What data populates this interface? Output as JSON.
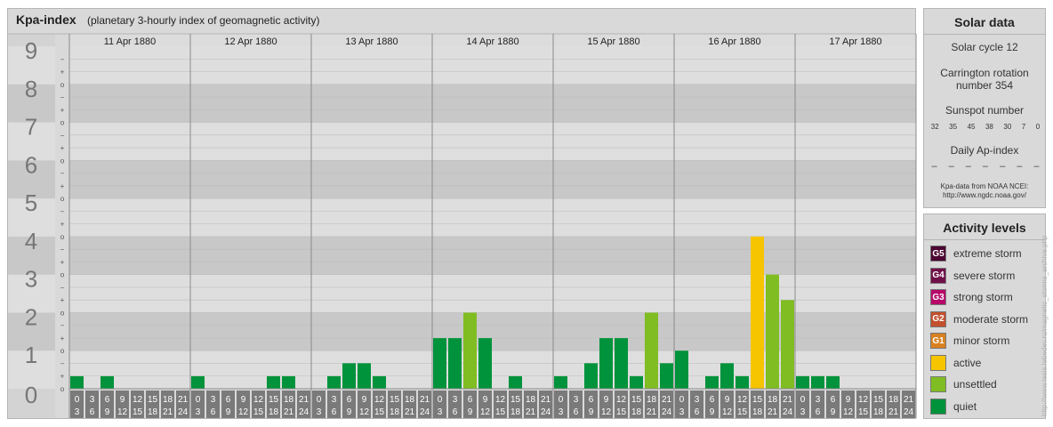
{
  "header": {
    "title": "Kpa-index",
    "subtitle": "(planetary 3-hourly index of geomagnetic activity)"
  },
  "chart_data": {
    "type": "bar",
    "ylim": [
      0,
      9
    ],
    "y_ticks": [
      "0",
      "1",
      "2",
      "3",
      "4",
      "5",
      "6",
      "7",
      "8",
      "9"
    ],
    "y_minor_marks": [
      "+",
      "o",
      "−"
    ],
    "days": [
      "11 Apr 1880",
      "12 Apr 1880",
      "13 Apr 1880",
      "14 Apr 1880",
      "15 Apr 1880",
      "16 Apr 1880",
      "17 Apr 1880"
    ],
    "interval_start_labels": [
      "0",
      "3",
      "6",
      "9",
      "12",
      "15",
      "18",
      "21"
    ],
    "interval_end_labels": [
      "3",
      "6",
      "9",
      "12",
      "15",
      "18",
      "21",
      "24"
    ],
    "values": [
      [
        0.33,
        0,
        0.33,
        0,
        0,
        0,
        0,
        0
      ],
      [
        0.33,
        0,
        0,
        0,
        0,
        0.33,
        0.33,
        0
      ],
      [
        0,
        0.33,
        0.67,
        0.67,
        0.33,
        0,
        0,
        0
      ],
      [
        1.33,
        1.33,
        2,
        1.33,
        0,
        0.33,
        0,
        0
      ],
      [
        0.33,
        0,
        0.67,
        1.33,
        1.33,
        0.33,
        2,
        0.67
      ],
      [
        1,
        0,
        0.33,
        0.67,
        0.33,
        4,
        3,
        2.33
      ],
      [
        0.33,
        0.33,
        0.33,
        0,
        0,
        0,
        0,
        0
      ]
    ],
    "level_colors": {
      "quiet": "#00933b",
      "unsettled": "#80bd22",
      "active": "#f7c400",
      "g1": "#d98120",
      "g2": "#c2502e",
      "g3": "#b7086a",
      "g4": "#701048",
      "g5": "#4c0531"
    },
    "band_colors": [
      "#dedede",
      "#c8c8c8"
    ],
    "plot_background": "#e8e8e8"
  },
  "solar": {
    "title": "Solar data",
    "cycle": "Solar cycle 12",
    "carrington_line1": "Carrington rotation",
    "carrington_line2": "number 354",
    "sunspot_title": "Sunspot number",
    "sunspot_values": [
      "32",
      "35",
      "45",
      "38",
      "30",
      "7",
      "0"
    ],
    "ap_title": "Daily Ap-index",
    "ap_values": [
      "–",
      "–",
      "–",
      "–",
      "–",
      "–",
      "–"
    ],
    "source_line1": "Kpa-data from NOAA NCEI:",
    "source_line2": "http://www.ngdc.noaa.gov/"
  },
  "levels": {
    "title": "Activity levels",
    "items": [
      {
        "code": "G5",
        "label": "extreme storm",
        "color": "#4c0531"
      },
      {
        "code": "G4",
        "label": "severe storm",
        "color": "#701048"
      },
      {
        "code": "G3",
        "label": "strong storm",
        "color": "#b7086a"
      },
      {
        "code": "G2",
        "label": "moderate storm",
        "color": "#c2502e"
      },
      {
        "code": "G1",
        "label": "minor storm",
        "color": "#d98120"
      },
      {
        "code": "",
        "label": "active",
        "color": "#f7c400"
      },
      {
        "code": "",
        "label": "unsettled",
        "color": "#80bd22"
      },
      {
        "code": "",
        "label": "quiet",
        "color": "#00933b"
      }
    ]
  },
  "credit": "http://www.tesis.lebedev.ru/magnetic_storms_archive.php"
}
